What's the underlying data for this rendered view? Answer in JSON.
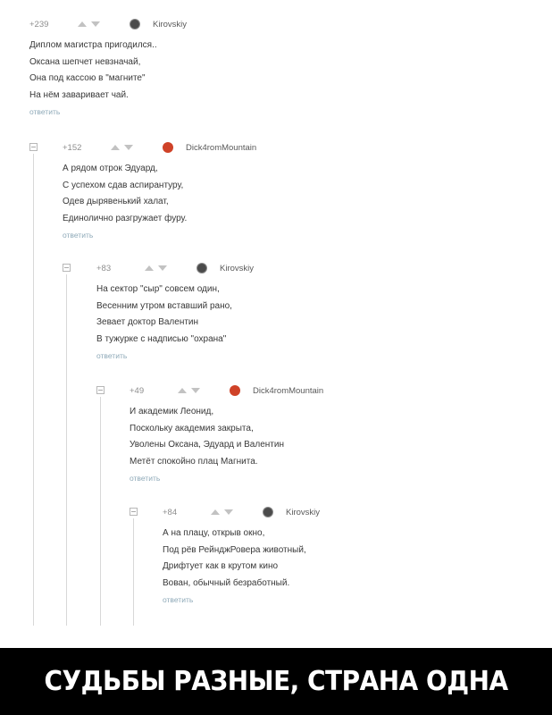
{
  "comments": [
    {
      "rating": "+239",
      "author": "Kirovskiy",
      "reply": "ответить",
      "lines": [
        "Диплом магистра пригодился..",
        "Оксана шепчет невзначай,",
        "Она под кассою в \"магните\"",
        "На нём заваривает чай."
      ]
    },
    {
      "rating": "+152",
      "author": "Dick4romMountain",
      "reply": "ответить",
      "lines": [
        "А рядом отрок Эдуард,",
        "С успехом сдав аспирантуру,",
        "Одев дырявенький халат,",
        "Единолично разгружает фуру."
      ]
    },
    {
      "rating": "+83",
      "author": "Kirovskiy",
      "reply": "ответить",
      "lines": [
        "На сектор \"сыр\" совсем один,",
        "Весенним утром вставший рано,",
        "Зевает доктор Валентин",
        "В тужурке с надписью \"охрана\""
      ]
    },
    {
      "rating": "+49",
      "author": "Dick4romMountain",
      "reply": "ответить",
      "lines": [
        "И академик Леонид,",
        "Поскольку академия закрыта,",
        "Уволены Оксана, Эдуард и Валентин",
        "Метёт спокойно плац Магнита."
      ]
    },
    {
      "rating": "+84",
      "author": "Kirovskiy",
      "reply": "ответить",
      "lines": [
        "А на плацу, открыв окно,",
        "Под рёв РейнджРовера животный,",
        "Дрифтует как в крутом кино",
        "Вован, обычный безработный."
      ]
    }
  ],
  "caption": "СУДЬБЫ РАЗНЫЕ, СТРАНА ОДНА",
  "colors": {
    "reply_link": "#8ea9b8",
    "avatar_red": "#cf4228",
    "banner_bg": "#000000"
  }
}
